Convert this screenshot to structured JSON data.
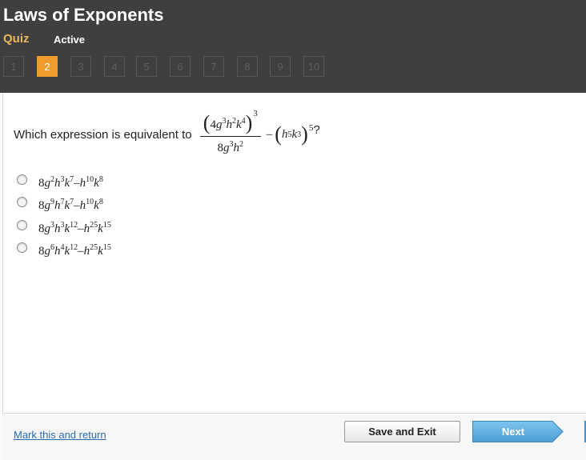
{
  "header": {
    "title": "Laws of Exponents",
    "quiz_label": "Quiz",
    "status": "Active",
    "active_step": 2,
    "steps": [
      "1",
      "2",
      "3",
      "4",
      "5",
      "6",
      "7",
      "8",
      "9",
      "10"
    ]
  },
  "question": {
    "prefix": "Which expression is equivalent to ",
    "numerator": {
      "coef": "4",
      "g": "g",
      "g_exp": "3",
      "h": "h",
      "h_exp": "2",
      "k": "k",
      "k_exp": "4",
      "outer_exp": "3"
    },
    "denominator": {
      "coef": "8",
      "g": "g",
      "g_exp": "3",
      "h": "h",
      "h_exp": "2"
    },
    "minus": "–",
    "tail": {
      "h": "h",
      "h_exp": "5",
      "k": "k",
      "k_exp": "3",
      "outer_exp": "5"
    },
    "suffix": "?"
  },
  "options": [
    {
      "coef": "8",
      "g_exp": "2",
      "h_exp": "3",
      "k_exp": "7",
      "h2_exp": "10",
      "k2_exp": "8"
    },
    {
      "coef": "8",
      "g_exp": "9",
      "h_exp": "7",
      "k_exp": "7",
      "h2_exp": "10",
      "k2_exp": "8"
    },
    {
      "coef": "8",
      "g_exp": "3",
      "h_exp": "3",
      "k_exp": "12",
      "h2_exp": "25",
      "k2_exp": "15"
    },
    {
      "coef": "8",
      "g_exp": "6",
      "h_exp": "4",
      "k_exp": "12",
      "h2_exp": "25",
      "k2_exp": "15"
    }
  ],
  "footer": {
    "mark_link": "Mark this and return",
    "save_exit": "Save and Exit",
    "next": "Next"
  },
  "colors": {
    "header_bg": "#3f3f3f",
    "quiz_label": "#e8b85a",
    "active_step": "#f09a2b",
    "next_button": "#56aee6",
    "link": "#2a6bb0"
  }
}
